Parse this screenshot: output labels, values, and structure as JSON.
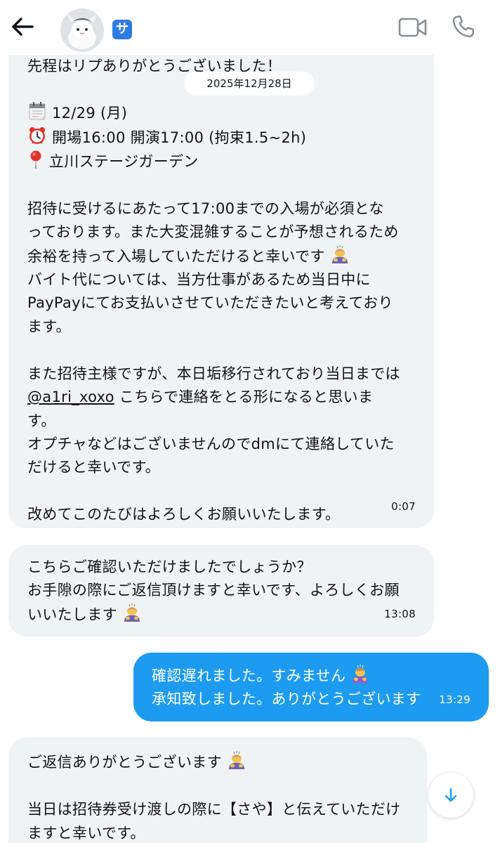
{
  "header": {
    "badge": "サ",
    "icons": [
      "back-arrow-icon",
      "video-camera-icon",
      "phone-icon"
    ]
  },
  "date_separator": "2025年12月28日",
  "messages": [
    {
      "direction": "incoming",
      "lines": {
        "l1": "先程はリプありがとうございました！",
        "l2": "12/29 (月)",
        "l3": "開場16:00 開演17:00 (拘束1.5~2h)",
        "l4": "立川ステージガーデン",
        "l5": "招待に受けるにあたって17:00までの入場が必須とな",
        "l6": "っております。また大変混雑することが予想されるため",
        "l7": "余裕を持って入場していただけると幸いです",
        "l8": "バイト代については、当方仕事があるため当日中に",
        "l9": "PayPayにてお支払いさせていただきたいと考えており",
        "l10": "ます。",
        "l11": "また招待主様ですが、本日垢移行されており当日までは",
        "l12_mention": "@a1ri_xoxo",
        "l12_rest": " こちらで連絡をとる形になると思いま",
        "l13": "す。",
        "l14": "オプチャなどはございませんのでdmにて連絡していた",
        "l15": "だけると幸いです。",
        "l16": "改めてこのたびはよろしくお願いいたします。"
      },
      "time": "0:07"
    },
    {
      "direction": "incoming",
      "lines": {
        "l1": "こちらご確認いただけましたでしょうか？",
        "l2": "お手隙の際にご返信頂けますと幸いです、よろしくお願",
        "l3": "いいたします"
      },
      "time": "13:08"
    },
    {
      "direction": "outgoing",
      "lines": {
        "l1": "確認遅れました。すみません",
        "l2": "承知致しました。ありがとうございます"
      },
      "time": "13:29"
    },
    {
      "direction": "incoming",
      "lines": {
        "l1": "ご返信ありがとうございます",
        "l2": "当日は招待券受け渡しの際に【さや】と伝えていただけ",
        "l3": "ますと幸いです。"
      }
    }
  ],
  "emoji_icons": [
    "calendar-icon",
    "alarm-clock-icon",
    "round-pushpin-icon",
    "bowing-person-icon"
  ],
  "colors": {
    "incoming_bubble": "#eff3f4",
    "outgoing_bubble": "#1d9bf0",
    "badge": "#2f7be6",
    "accent": "#1d9bf0"
  }
}
